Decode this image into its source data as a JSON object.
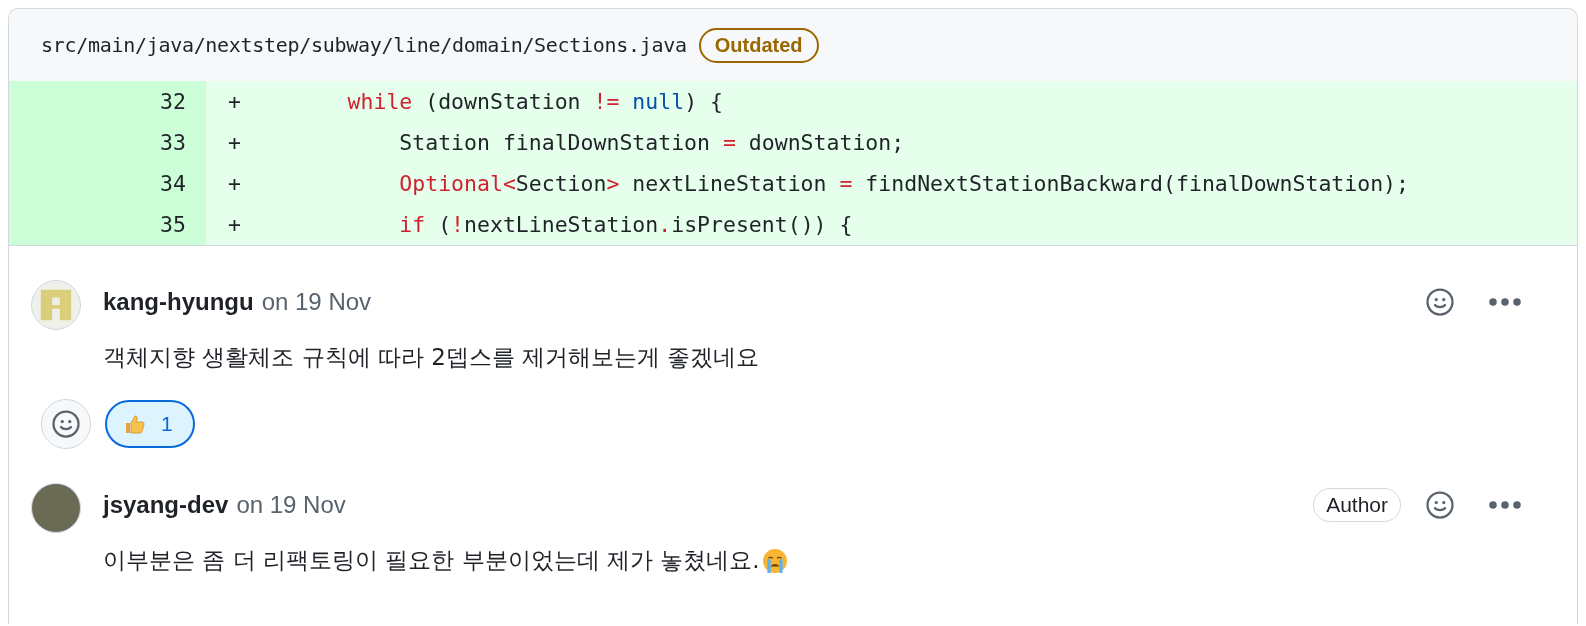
{
  "file": {
    "path": "src/main/java/nextstep/subway/line/domain/Sections.java",
    "badge": "Outdated"
  },
  "diff_lines": [
    {
      "number": "32",
      "sign": "+",
      "tokens": [
        {
          "kind": "keyword",
          "text": "        while"
        },
        {
          "kind": "plain",
          "text": " (downStation "
        },
        {
          "kind": "keyword",
          "text": "!="
        },
        {
          "kind": "literal",
          "text": " null"
        },
        {
          "kind": "plain",
          "text": ") {"
        }
      ]
    },
    {
      "number": "33",
      "sign": "+",
      "tokens": [
        {
          "kind": "plain",
          "text": "            Station finalDownStation "
        },
        {
          "kind": "keyword",
          "text": "="
        },
        {
          "kind": "plain",
          "text": " downStation;"
        }
      ]
    },
    {
      "number": "34",
      "sign": "+",
      "tokens": [
        {
          "kind": "keyword",
          "text": "            Optional<"
        },
        {
          "kind": "plain",
          "text": "Section"
        },
        {
          "kind": "keyword",
          "text": ">"
        },
        {
          "kind": "plain",
          "text": " nextLineStation "
        },
        {
          "kind": "keyword",
          "text": "="
        },
        {
          "kind": "plain",
          "text": " findNextStationBackward(finalDownStation);"
        }
      ]
    },
    {
      "number": "35",
      "sign": "+",
      "tokens": [
        {
          "kind": "keyword",
          "text": "            if"
        },
        {
          "kind": "plain",
          "text": " ("
        },
        {
          "kind": "keyword",
          "text": "!"
        },
        {
          "kind": "plain",
          "text": "nextLineStation"
        },
        {
          "kind": "keyword",
          "text": "."
        },
        {
          "kind": "plain",
          "text": "isPresent()) {"
        }
      ]
    }
  ],
  "comments": [
    {
      "kind": "identicon",
      "author": "kang-hyungu",
      "date": "on 19 Nov",
      "body": [
        {
          "kind": "text",
          "text": "객체지향 생활체조 규칙에 따라 2뎁스를 제거해보는게 좋겠네요"
        }
      ],
      "reactions": [
        {
          "count": "1",
          "selected": true
        }
      ]
    },
    {
      "kind": "photo",
      "author": "jsyang-dev",
      "date": "on 19 Nov",
      "badge": "Author",
      "body": [
        {
          "kind": "text",
          "text": "이부분은 좀 더 리팩토링이 필요한 부분이었는데 제가 놓쳤네요."
        },
        {
          "kind": "crying_face"
        }
      ]
    }
  ]
}
